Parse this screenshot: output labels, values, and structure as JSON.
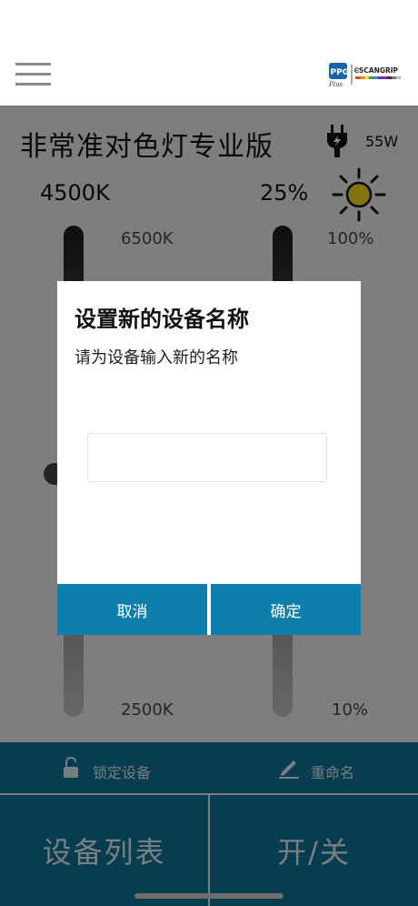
{
  "header": {
    "logo_icon": "ppg-scangrip-logo",
    "menu_icon": "hamburger-menu-icon"
  },
  "device": {
    "title": "非常准对色灯专业版",
    "power_icon": "plug-icon",
    "power": "55W",
    "kelvin": "4500K",
    "brightness": "25%",
    "brightness_icon": "sun-icon",
    "kelvin_scale": {
      "top": "6500K",
      "bottom": "2500K"
    },
    "brightness_scale": {
      "top": "100%",
      "bottom": "10%"
    },
    "kelvin_level": 0.5,
    "brightness_level": 0.25
  },
  "actions": {
    "lock_label": "锁定设备",
    "lock_icon": "padlock-icon",
    "rename_label": "重命名",
    "rename_icon": "pencil-icon"
  },
  "buttons": {
    "device_list": "设备列表",
    "power_toggle": "开/关"
  },
  "dialog": {
    "title": "设置新的设备名称",
    "message": "请为设备输入新的名称",
    "input_value": "",
    "input_placeholder": "",
    "cancel": "取消",
    "confirm": "确定"
  },
  "colors": {
    "primary": "#0f6d91",
    "dialog_button": "#0d7fac",
    "sun_yellow": "#f2d21b"
  }
}
